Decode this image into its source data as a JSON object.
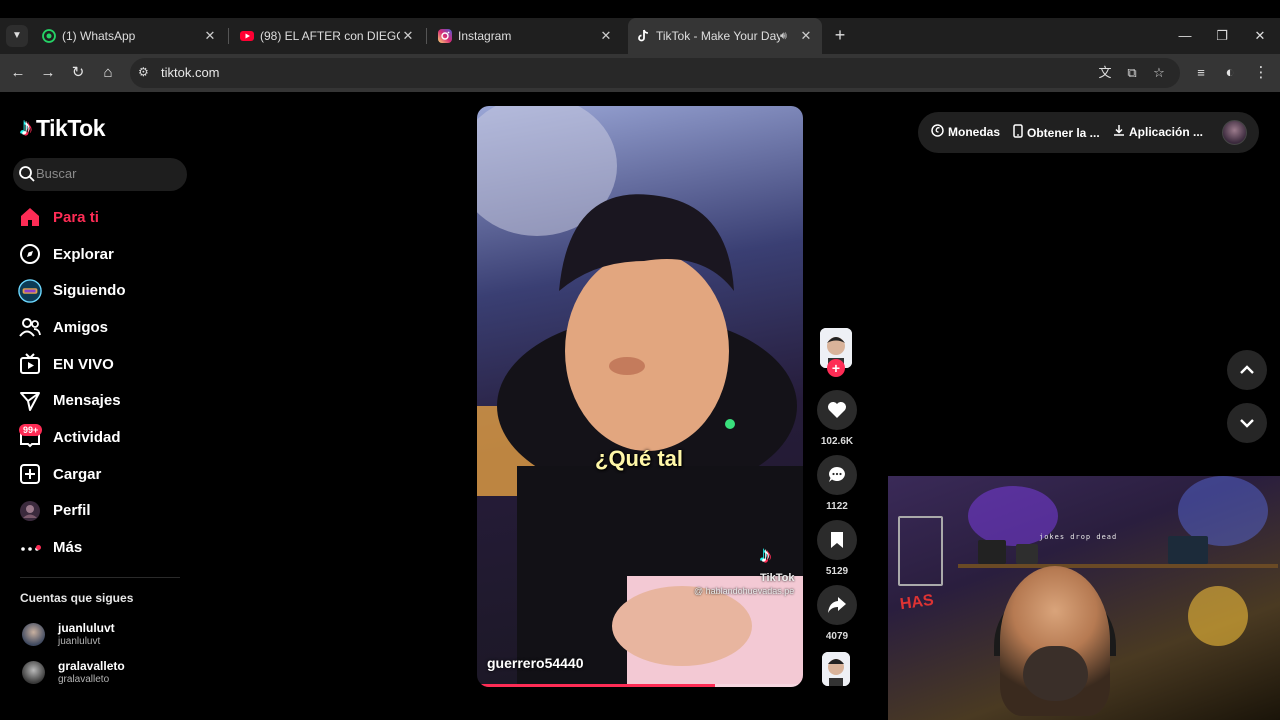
{
  "browser": {
    "tabs": [
      {
        "title": "(1) WhatsApp",
        "favicon": "whatsapp-icon",
        "color": "#25d366",
        "active": false
      },
      {
        "title": "(98) EL AFTER con DIEGO POGG",
        "favicon": "youtube-icon",
        "color": "#ff0033",
        "active": false
      },
      {
        "title": "Instagram",
        "favicon": "instagram-icon",
        "color": "#e1306c",
        "active": false
      },
      {
        "title": "TikTok - Make Your Day",
        "favicon": "tiktok-icon",
        "color": "#ffffff",
        "active": true
      }
    ],
    "url": "tiktok.com"
  },
  "sidebar": {
    "logo": "TikTok",
    "search_placeholder": "Buscar",
    "nav": [
      {
        "label": "Para ti",
        "icon": "home-icon",
        "active": true
      },
      {
        "label": "Explorar",
        "icon": "compass-icon"
      },
      {
        "label": "Siguiendo",
        "icon": "following-avatar-icon"
      },
      {
        "label": "Amigos",
        "icon": "friends-icon"
      },
      {
        "label": "EN VIVO",
        "icon": "live-tv-icon"
      },
      {
        "label": "Mensajes",
        "icon": "send-icon"
      },
      {
        "label": "Actividad",
        "icon": "inbox-icon",
        "badge": "99+"
      },
      {
        "label": "Cargar",
        "icon": "upload-icon"
      },
      {
        "label": "Perfil",
        "icon": "profile-avatar-icon"
      },
      {
        "label": "Más",
        "icon": "more-icon"
      }
    ],
    "following_title": "Cuentas que sigues",
    "following": [
      {
        "name": "juanluluvt",
        "handle": "juanluluvt"
      },
      {
        "name": "gralavalleto",
        "handle": "gralavalleto"
      }
    ]
  },
  "video": {
    "caption": "¿Qué tal",
    "watermark": "TikTok",
    "watermark_handle": "@ hablandohuevadas.pe",
    "author": "guerrero54440",
    "progress": 0.73
  },
  "actions": {
    "likes": "102.6K",
    "comments": "1122",
    "saves": "5129",
    "shares": "4079"
  },
  "topbar": {
    "coins": "Monedas",
    "get_app": "Obtener la ...",
    "desktop_app": "Aplicación ..."
  },
  "webcam": {
    "sign_text": "HAS",
    "banner_text": "jokes drop dead"
  }
}
